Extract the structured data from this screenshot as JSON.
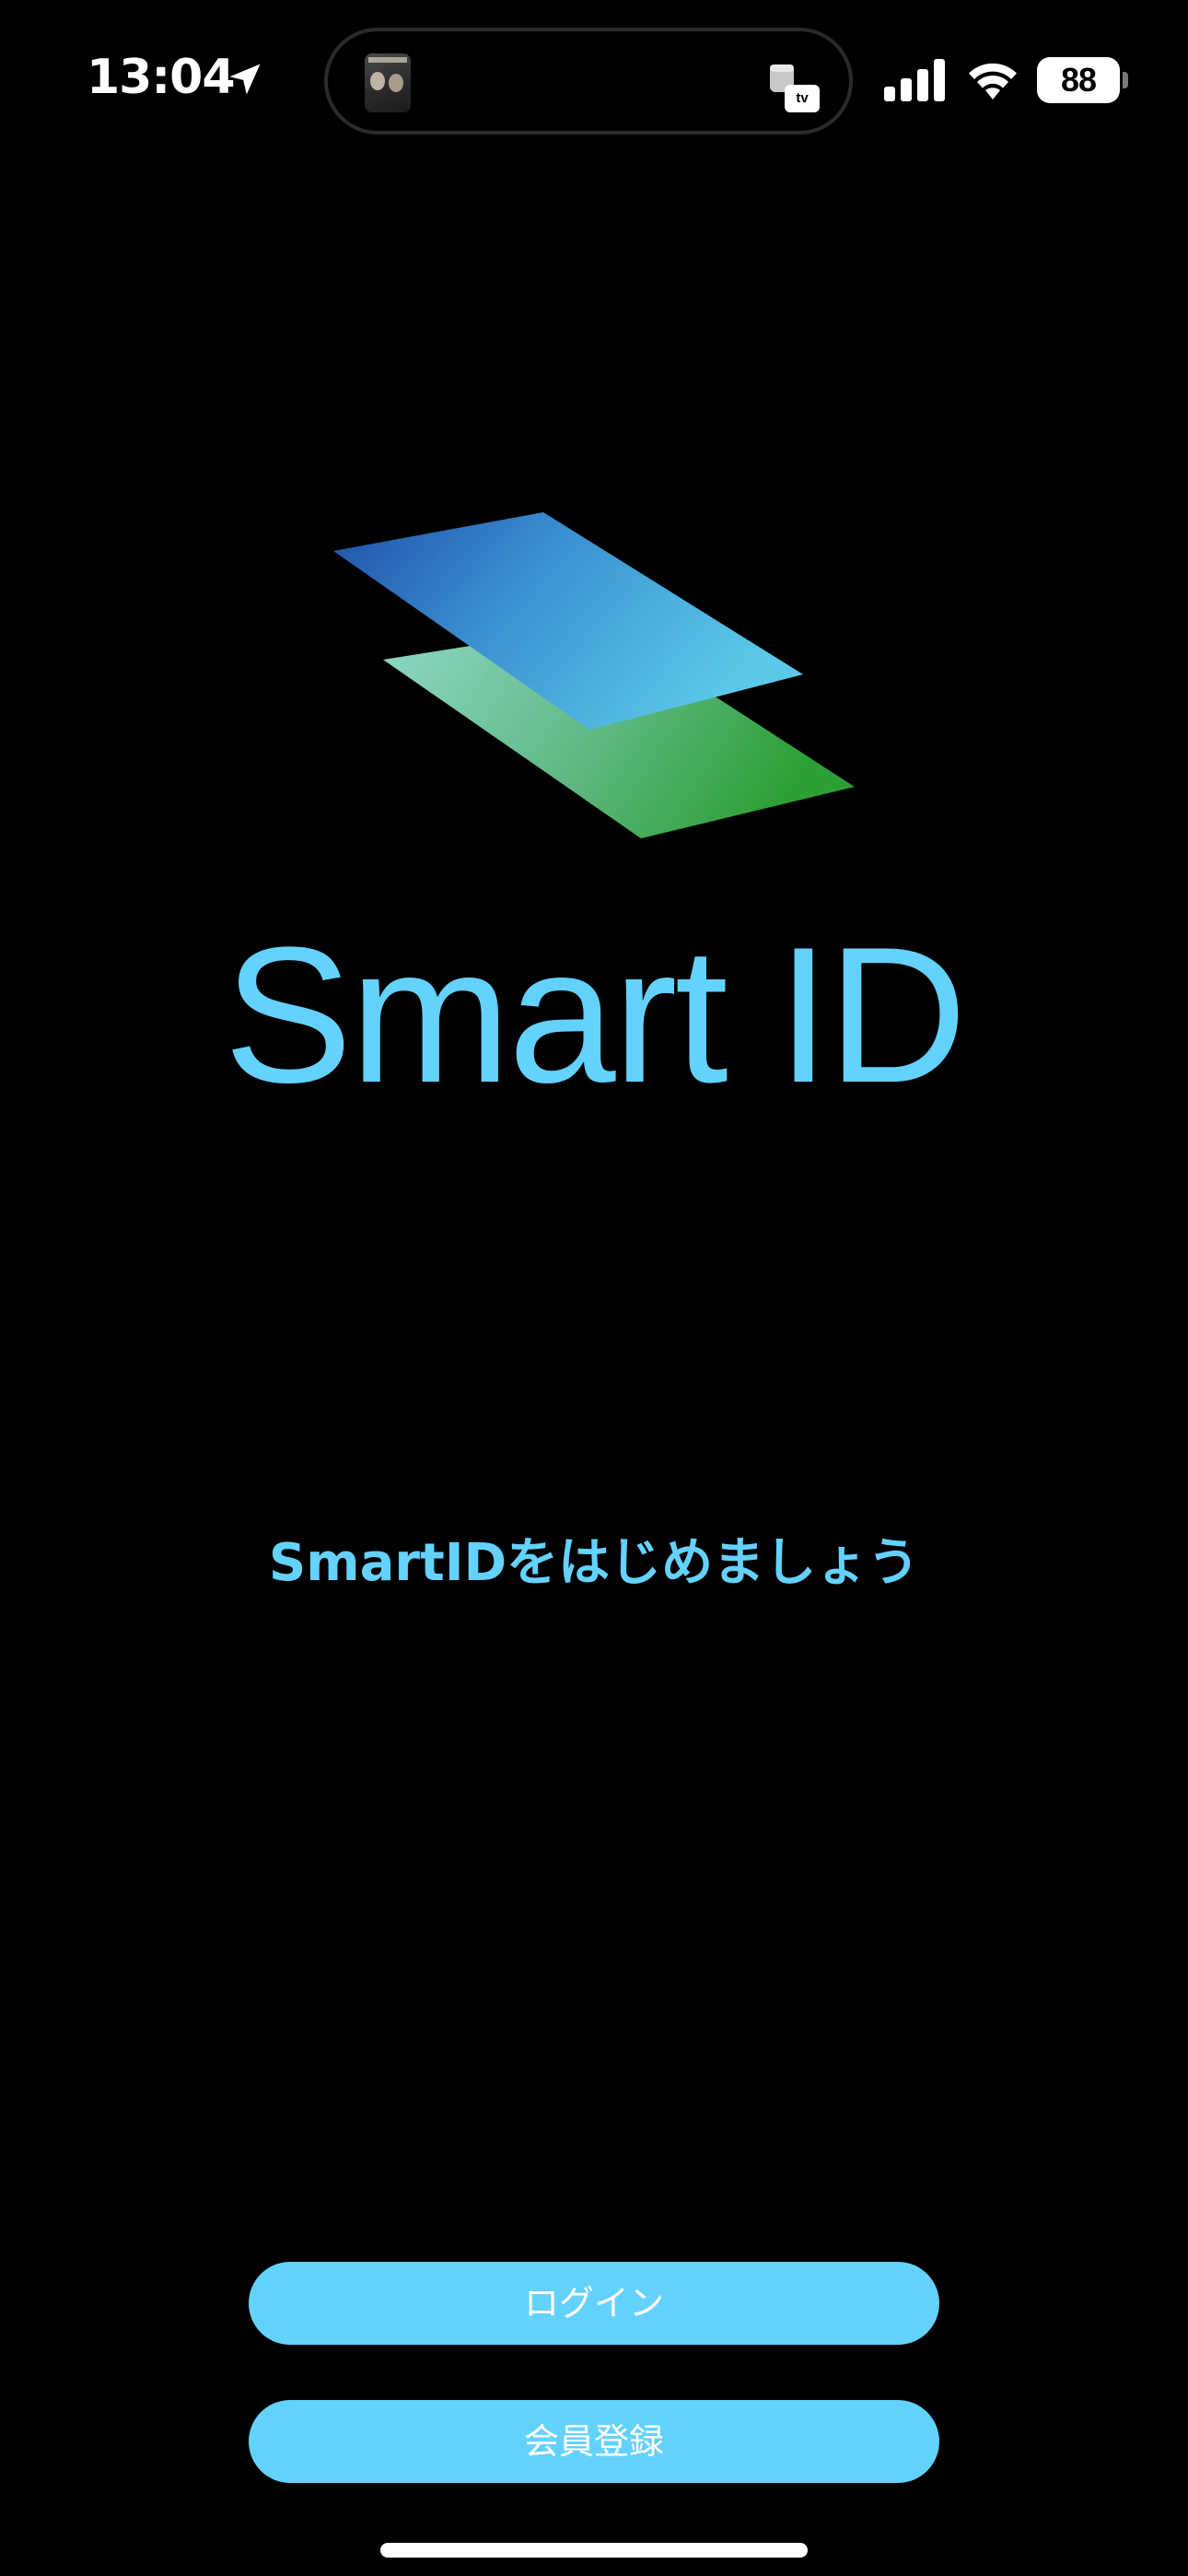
{
  "status_bar": {
    "time": "13:04",
    "battery_level": "88",
    "icons": [
      "location-arrow-icon",
      "signal-bars-icon",
      "wifi-icon",
      "battery-icon"
    ],
    "live_activity": {
      "artwork": "now-playing-artwork",
      "app_badge": "tv"
    }
  },
  "app": {
    "name": "Smart ID",
    "tagline": "SmartIDをはじめましょう"
  },
  "actions": {
    "login_label": "ログイン",
    "register_label": "会員登録"
  },
  "colors": {
    "background": "#000000",
    "accent": "#64d2ff",
    "logo_top_start": "#1f4fa8",
    "logo_top_end": "#55c6e6",
    "logo_bottom_start": "#8fd8c8",
    "logo_bottom_end": "#2ea13a"
  }
}
